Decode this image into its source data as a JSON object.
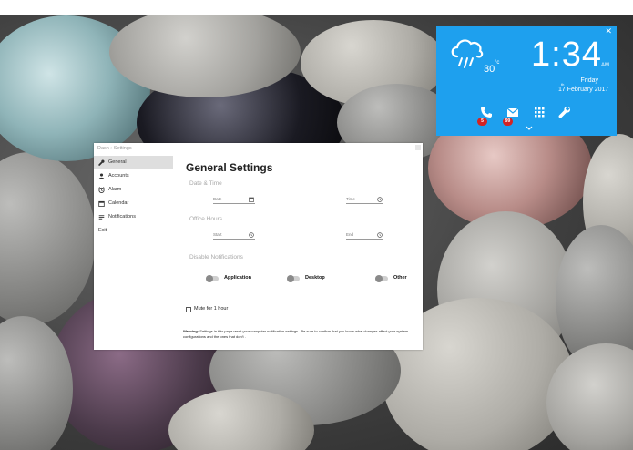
{
  "widget": {
    "temperature": "30",
    "temp_unit": "°c",
    "time": "1:34",
    "ampm": "AM",
    "day": "Friday",
    "date_day": "17",
    "date_suffix": "th",
    "date_rest": "February 2017",
    "missed_calls": "5",
    "unread_mail": "99",
    "icons": [
      "cloud-rain-icon",
      "phone-icon",
      "mail-icon",
      "apps-grid-icon",
      "wrench-icon",
      "chevron-down-icon"
    ],
    "accent": "#1ea0ee",
    "badge_color": "#d32424"
  },
  "window": {
    "breadcrumb": "Dash  ›  Settings",
    "title": "General Settings",
    "exit_label": "Exit",
    "nav": [
      {
        "label": "General",
        "icon": "wrench-icon",
        "active": true
      },
      {
        "label": "Accounts",
        "icon": "person-icon",
        "active": false
      },
      {
        "label": "Alarm",
        "icon": "alarm-clock-icon",
        "active": false
      },
      {
        "label": "Calendar",
        "icon": "calendar-icon",
        "active": false
      },
      {
        "label": "Notifications",
        "icon": "notifications-icon",
        "active": false
      }
    ],
    "sections": {
      "date_time": "Date & Time",
      "office_hours": "Office Hours",
      "disable_notifications": "Disable Notifications"
    },
    "fields": {
      "date_placeholder": "Date",
      "time_placeholder": "Time",
      "start_placeholder": "Start",
      "end_placeholder": "End"
    },
    "toggles": {
      "application": "Application",
      "desktop": "Desktop",
      "other": "Other"
    },
    "mute_label": "Mute for 1 hour",
    "warning_bold": "Warning:",
    "warning_text": " Settings in this page reset your computer notification settings . Be sure to confirm that you know what changes affect your system configurations and the ones that don't ."
  }
}
